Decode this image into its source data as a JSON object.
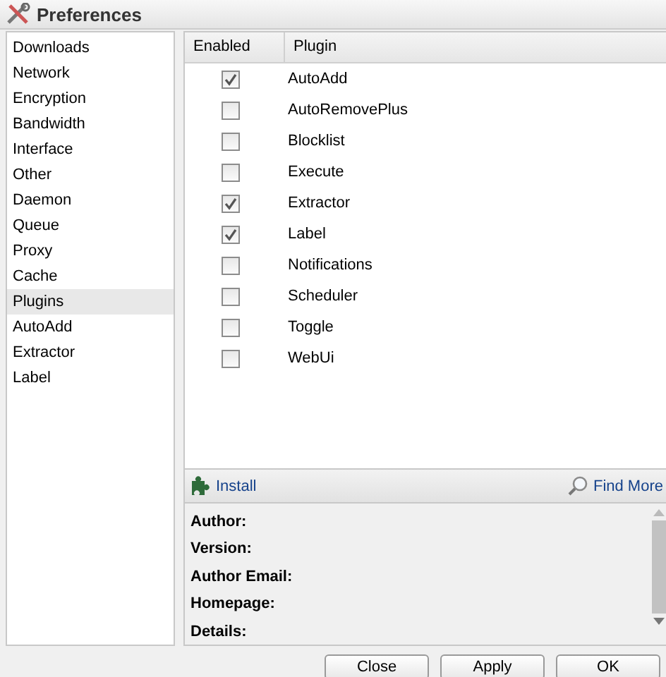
{
  "window": {
    "title": "Preferences"
  },
  "sidebar": {
    "items": [
      {
        "label": "Downloads",
        "selected": false
      },
      {
        "label": "Network",
        "selected": false
      },
      {
        "label": "Encryption",
        "selected": false
      },
      {
        "label": "Bandwidth",
        "selected": false
      },
      {
        "label": "Interface",
        "selected": false
      },
      {
        "label": "Other",
        "selected": false
      },
      {
        "label": "Daemon",
        "selected": false
      },
      {
        "label": "Queue",
        "selected": false
      },
      {
        "label": "Proxy",
        "selected": false
      },
      {
        "label": "Cache",
        "selected": false
      },
      {
        "label": "Plugins",
        "selected": true
      },
      {
        "label": "AutoAdd",
        "selected": false
      },
      {
        "label": "Extractor",
        "selected": false
      },
      {
        "label": "Label",
        "selected": false
      }
    ]
  },
  "table": {
    "columns": [
      "Enabled",
      "Plugin"
    ],
    "rows": [
      {
        "plugin": "AutoAdd",
        "checked": true
      },
      {
        "plugin": "AutoRemovePlus",
        "checked": false
      },
      {
        "plugin": "Blocklist",
        "checked": false
      },
      {
        "plugin": "Execute",
        "checked": false
      },
      {
        "plugin": "Extractor",
        "checked": true
      },
      {
        "plugin": "Label",
        "checked": true
      },
      {
        "plugin": "Notifications",
        "checked": false
      },
      {
        "plugin": "Scheduler",
        "checked": false
      },
      {
        "plugin": "Toggle",
        "checked": false
      },
      {
        "plugin": "WebUi",
        "checked": false
      }
    ]
  },
  "toolbar": {
    "install": "Install",
    "find_more": "Find More"
  },
  "info": {
    "fields": [
      "Author:",
      "Version:",
      "Author Email:",
      "Homepage:",
      "Details:"
    ]
  },
  "buttons": [
    "Close",
    "Apply",
    "OK"
  ]
}
